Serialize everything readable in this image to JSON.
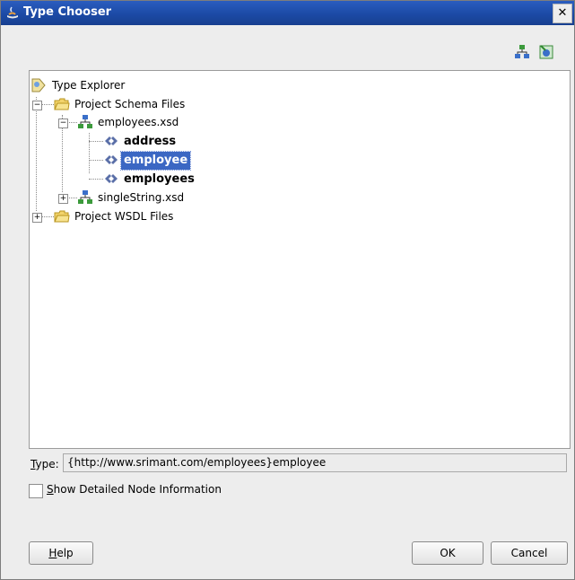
{
  "window": {
    "title": "Type Chooser",
    "close_glyph": "✕"
  },
  "toolbar": {
    "icons": [
      "new-schema-icon",
      "import-icon"
    ]
  },
  "tree": {
    "root": "Type Explorer",
    "project_schema_files": "Project Schema Files",
    "employees_xsd": "employees.xsd",
    "elements": [
      "address",
      "employee",
      "employees"
    ],
    "selected": "employee",
    "single_string_xsd": "singleString.xsd",
    "project_wsdl_files": "Project WSDL Files"
  },
  "type_field": {
    "label_mnemonic": "T",
    "label_rest": "ype:",
    "value": "{http://www.srimant.com/employees}employee"
  },
  "detail_checkbox": {
    "mnemonic": "S",
    "label_rest": "how Detailed Node Information",
    "checked": false
  },
  "buttons": {
    "help_mnemonic": "H",
    "help_rest": "elp",
    "ok": "OK",
    "cancel": "Cancel"
  },
  "colors": {
    "title_bar": "#1c4aa6",
    "selection": "#3b67c3"
  }
}
